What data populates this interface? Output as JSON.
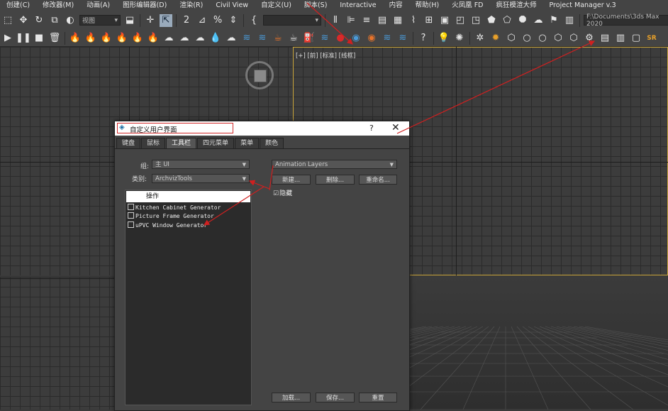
{
  "menu": [
    "创建(C)",
    "修改器(M)",
    "动画(A)",
    "图形编辑器(D)",
    "渲染(R)",
    "Civil View",
    "自定义(U)",
    "脚本(S)",
    "Interactive",
    "内容",
    "帮助(H)",
    "火凤凰 FD",
    "疯狂模渲大师",
    "Project Manager v.3"
  ],
  "toolbar": {
    "view_combo": "视图",
    "path_combo": "F:\\Documents\\3ds Max 2020",
    "sr_label": "SR"
  },
  "viewport": {
    "top_right_label": "[+] [前] [标准] [线框]"
  },
  "dialog": {
    "title": "自定义用户界面",
    "help": "?",
    "close": "✕",
    "tabs": [
      "键盘",
      "鼠标",
      "工具栏",
      "四元菜单",
      "菜单",
      "颜色"
    ],
    "active_tab": "工具栏",
    "group_label": "组:",
    "group_value": "主 UI",
    "category_label": "类别:",
    "category_value": "ArchvizTools",
    "action_header": "操作",
    "actions": [
      "Kitchen Cabinet Generator",
      "Picture Frame Generator",
      "uPVC Window Generator"
    ],
    "toolbar_select": "Animation Layers",
    "new_btn": "新建...",
    "delete_btn": "删除...",
    "rename_btn": "重命名...",
    "hide_label": "隐藏",
    "hide_checked": true,
    "load_btn": "加载...",
    "save_btn": "保存...",
    "reset_btn": "重置"
  }
}
